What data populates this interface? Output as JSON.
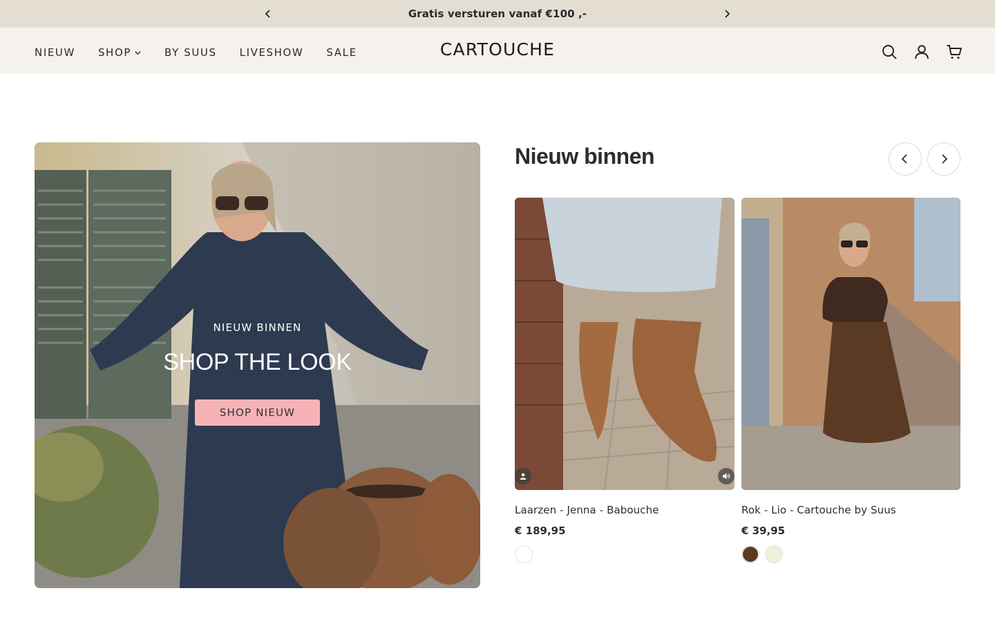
{
  "announcement": {
    "text": "Gratis versturen vanaf €100 ,-"
  },
  "header": {
    "nav": [
      {
        "label": "NIEUW"
      },
      {
        "label": "SHOP"
      },
      {
        "label": "BY SUUS"
      },
      {
        "label": "LIVESHOW"
      },
      {
        "label": "SALE"
      }
    ],
    "logo": "CARTOUCHE",
    "icons": [
      "search-icon",
      "account-icon",
      "cart-icon"
    ]
  },
  "hero": {
    "kicker": "NIEUW BINNEN",
    "title": "SHOP THE LOOK",
    "button_label": "SHOP NIEUW",
    "button_color": "#f6b3b6"
  },
  "new_arrivals": {
    "title": "Nieuw binnen",
    "products": [
      {
        "name": "Laarzen - Jenna - Babouche",
        "price": "€ 189,95",
        "swatches": [
          "#ffffff"
        ]
      },
      {
        "name": "Rok - Lio - Cartouche by Suus",
        "price": "€ 39,95",
        "swatches": [
          "#5a3a1c",
          "#eef2dc"
        ]
      }
    ]
  },
  "colors": {
    "announcement_bg": "#e4ddd2",
    "header_bg": "#f5f2ee",
    "accent_pink": "#f6b3b6"
  }
}
